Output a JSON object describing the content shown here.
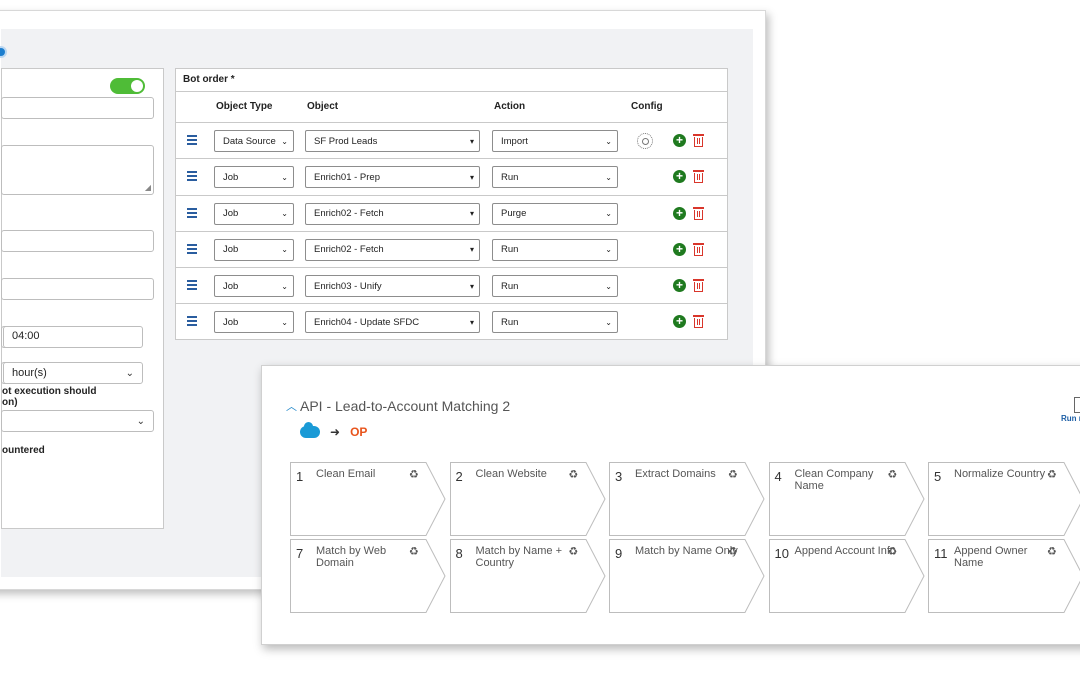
{
  "settings_panel": {
    "inputs": [
      {
        "value": "",
        "placeholder": ""
      },
      {
        "value": "",
        "placeholder": ""
      },
      {
        "value": "",
        "placeholder": ""
      }
    ],
    "time_value": "04:00",
    "interval_unit": "hour(s)",
    "label_execution": "ot execution should",
    "label_execution_2": "on)",
    "label_encountered": "ountered"
  },
  "bot_order": {
    "title": "Bot order *",
    "columns": [
      "Object Type",
      "Object",
      "Action",
      "Config"
    ],
    "rows": [
      {
        "type": "Data Source",
        "object": "SF Prod Leads",
        "action": "Import",
        "config": true
      },
      {
        "type": "Job",
        "object": "Enrich01 - Prep",
        "action": "Run",
        "config": false
      },
      {
        "type": "Job",
        "object": "Enrich02 - Fetch",
        "action": "Purge",
        "config": false
      },
      {
        "type": "Job",
        "object": "Enrich02 - Fetch",
        "action": "Run",
        "config": false
      },
      {
        "type": "Job",
        "object": "Enrich03 - Unify",
        "action": "Run",
        "config": false
      },
      {
        "type": "Job",
        "object": "Enrich04 - Update SFDC",
        "action": "Run",
        "config": false
      }
    ]
  },
  "workflow": {
    "title": "API - Lead-to-Account Matching 2",
    "collapse_icon": "chevron-up-icon",
    "source": "salesforce-cloud-icon",
    "target": "OP",
    "run_label": "Run r",
    "steps": [
      {
        "num": "1",
        "label": "Clean Email"
      },
      {
        "num": "2",
        "label": "Clean Website"
      },
      {
        "num": "3",
        "label": "Extract Domains"
      },
      {
        "num": "4",
        "label": "Clean Company Name"
      },
      {
        "num": "5",
        "label": "Normalize Country"
      },
      {
        "num": "7",
        "label": "Match by Web Domain"
      },
      {
        "num": "8",
        "label": "Match by Name + Country"
      },
      {
        "num": "9",
        "label": "Match by Name Only"
      },
      {
        "num": "10",
        "label": "Append Account Info"
      },
      {
        "num": "11",
        "label": "Append Owner Name"
      }
    ]
  },
  "colors": {
    "toggle_on": "#4fbc37",
    "add": "#1f7a1f",
    "delete": "#d9362b",
    "accent": "#1f86c9",
    "op_brand": "#e8541c"
  }
}
